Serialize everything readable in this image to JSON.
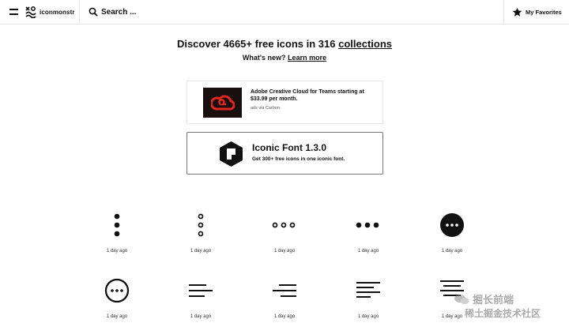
{
  "header": {
    "logo_text": "iconmonstr",
    "search_placeholder": "Search ...",
    "favorites_label": "My Favorites"
  },
  "hero": {
    "title_prefix": "Discover 4665+ free icons in 316 ",
    "title_link": "collections",
    "subtitle_prefix": "What's new? ",
    "subtitle_link": "Learn more"
  },
  "ad": {
    "text": "Adobe Creative Cloud for Teams starting at $33.99 per month.",
    "via": "ads via Carbon"
  },
  "promo": {
    "title": "Iconic Font 1.3.0",
    "subtitle": "Get 300+ free icons in one iconic font."
  },
  "icons": [
    {
      "name": "menu-dots-vertical-filled-icon",
      "age": "1 day ago"
    },
    {
      "name": "menu-dots-vertical-outline-icon",
      "age": "1 day ago"
    },
    {
      "name": "menu-dots-horizontal-outline-icon",
      "age": "1 day ago"
    },
    {
      "name": "menu-dots-horizontal-filled-icon",
      "age": "1 day ago"
    },
    {
      "name": "more-circle-filled-icon",
      "age": "1 day ago"
    },
    {
      "name": "more-circle-outline-icon",
      "age": "1 day ago"
    },
    {
      "name": "text-align-left-icon",
      "age": "1 day ago"
    },
    {
      "name": "text-align-right-icon",
      "age": "1 day ago"
    },
    {
      "name": "text-align-left-lines-icon",
      "age": "1 day ago"
    },
    {
      "name": "text-align-center-icon",
      "age": "1 day ago"
    }
  ],
  "watermark": {
    "line1": "掘长前端",
    "line2": "稀土掘金技术社区"
  },
  "colors": {
    "text": "#111111",
    "border": "#e6e6e6",
    "ad_red": "#e1261c"
  }
}
